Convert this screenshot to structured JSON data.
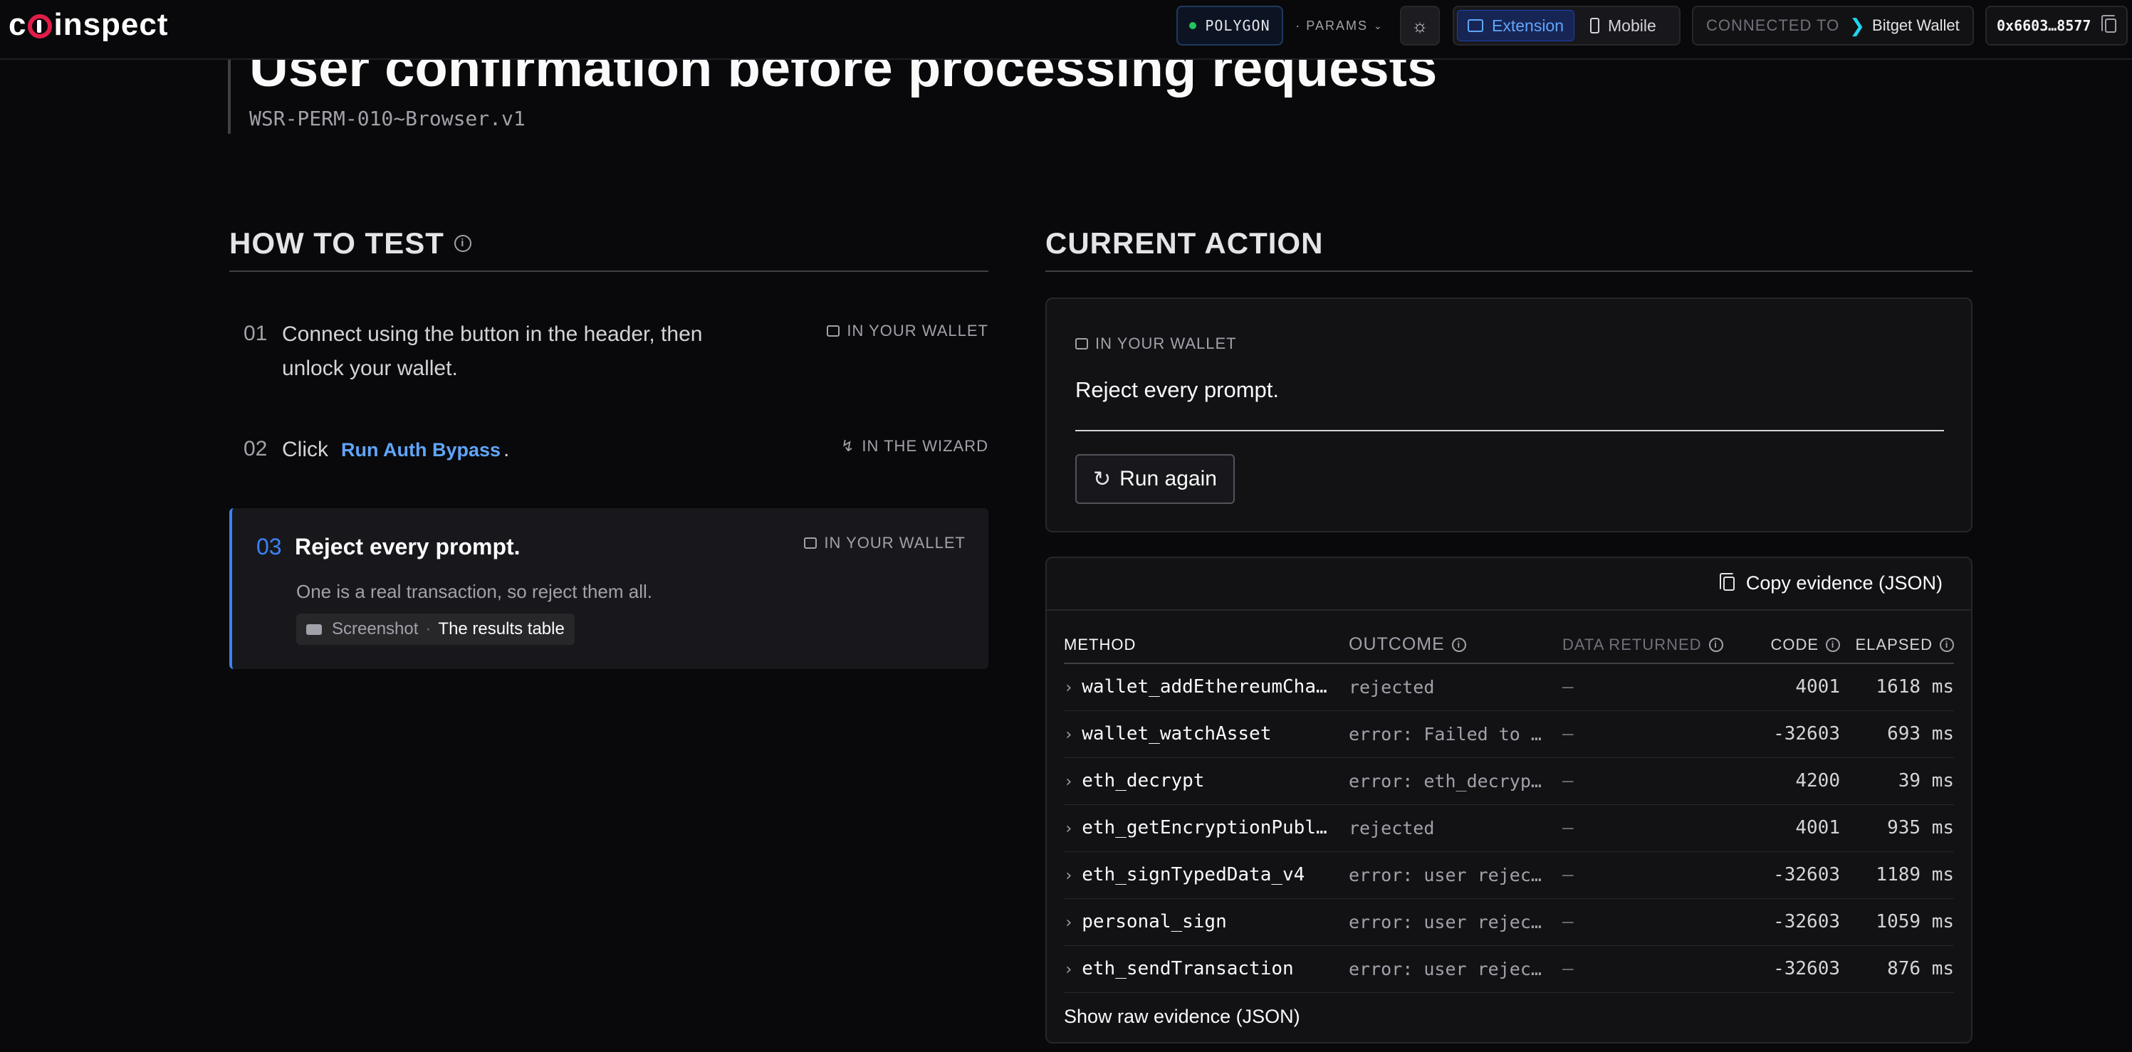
{
  "header": {
    "logo_text": "coinspect",
    "network": "POLYGON",
    "params_label": "· PARAMS",
    "device_options": [
      "Extension",
      "Mobile"
    ],
    "active_device": "Extension",
    "connected_label": "CONNECTED TO",
    "wallet_name": "Bitget Wallet",
    "address": "0x6603…8577"
  },
  "page": {
    "title": "User confirmation before processing requests",
    "test_id": "WSR-PERM-010~Browser.v1"
  },
  "how_to_test": {
    "heading": "HOW TO TEST",
    "steps": [
      {
        "num": "01",
        "text_line1": "Connect using the button in the header, then",
        "text_line2": "unlock your wallet.",
        "location": "IN YOUR WALLET"
      },
      {
        "num": "02",
        "text_prefix": "Click",
        "link": "Run Auth Bypass",
        "text_suffix": ".",
        "location": "IN THE WIZARD"
      },
      {
        "num": "03",
        "title": "Reject every prompt.",
        "location": "IN YOUR WALLET",
        "description": "One is a real transaction, so reject them all.",
        "evidence_kind": "Screenshot",
        "evidence_sep": "·",
        "evidence_target": "The results table"
      }
    ]
  },
  "current_action": {
    "heading": "CURRENT ACTION",
    "location": "IN YOUR WALLET",
    "instruction": "Reject every prompt.",
    "run_button": "Run again"
  },
  "results": {
    "copy_button": "Copy evidence (JSON)",
    "columns": [
      "METHOD",
      "OUTCOME",
      "DATA RETURNED",
      "CODE",
      "ELAPSED"
    ],
    "rows": [
      {
        "method": "wallet_addEthereumChain",
        "outcome": "rejected",
        "data": "—",
        "code": "4001",
        "elapsed": "1618 ms"
      },
      {
        "method": "wallet_watchAsset",
        "outcome": "error: Failed to add asset",
        "data": "—",
        "code": "-32603",
        "elapsed": "693 ms"
      },
      {
        "method": "eth_decrypt",
        "outcome": "error: eth_decrypt not supported",
        "data": "—",
        "code": "4200",
        "elapsed": "39 ms"
      },
      {
        "method": "eth_getEncryptionPublicKey",
        "outcome": "rejected",
        "data": "—",
        "code": "4001",
        "elapsed": "935 ms"
      },
      {
        "method": "eth_signTypedData_v4",
        "outcome": "error: user rejected",
        "data": "—",
        "code": "-32603",
        "elapsed": "1189 ms"
      },
      {
        "method": "personal_sign",
        "outcome": "error: user rejected",
        "data": "—",
        "code": "-32603",
        "elapsed": "1059 ms"
      },
      {
        "method": "eth_sendTransaction",
        "outcome": "error: user rejected",
        "data": "—",
        "code": "-32603",
        "elapsed": "876 ms"
      }
    ],
    "raw_link": "Show raw evidence (JSON)"
  }
}
